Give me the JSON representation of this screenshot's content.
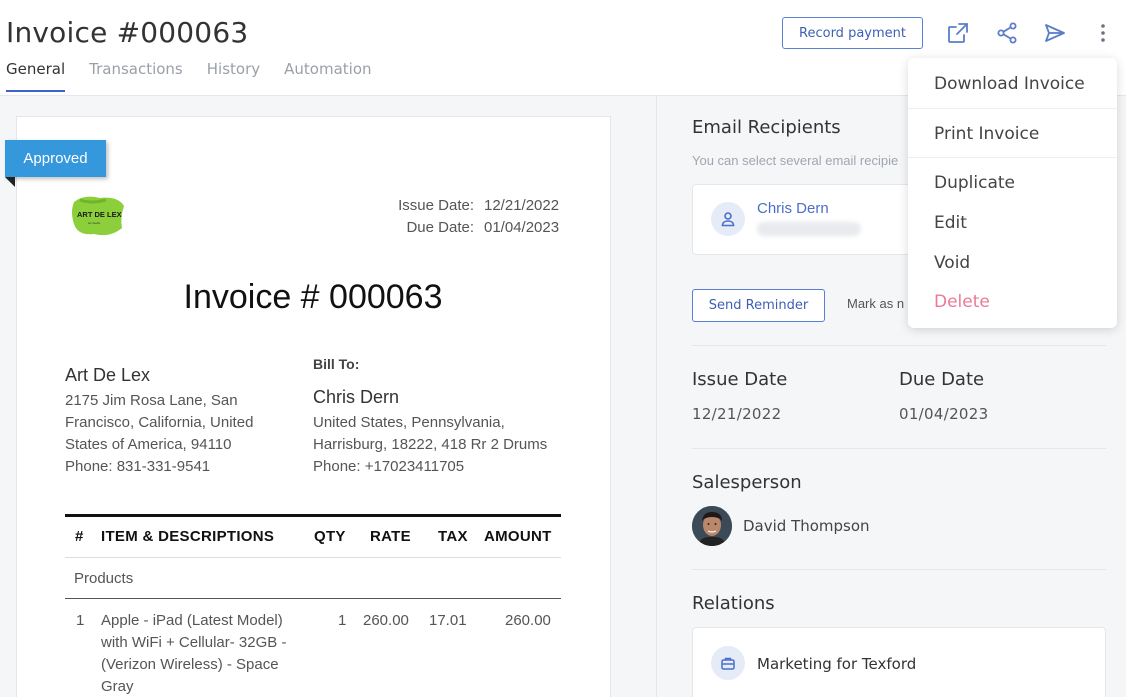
{
  "header": {
    "title": "Invoice #000063",
    "tabs": [
      {
        "label": "General",
        "active": true
      },
      {
        "label": "Transactions",
        "active": false
      },
      {
        "label": "History",
        "active": false
      },
      {
        "label": "Automation",
        "active": false
      }
    ],
    "record_payment_label": "Record payment",
    "icons": [
      "external-link-icon",
      "share-icon",
      "send-icon",
      "more-vertical-icon"
    ]
  },
  "invoice": {
    "status": "Approved",
    "logo_text": "ART DE LEX",
    "issue_date_label": "Issue Date:",
    "issue_date": "12/21/2022",
    "due_date_label": "Due Date:",
    "due_date": "01/04/2023",
    "heading": "Invoice # 000063",
    "from": {
      "name": "Art De Lex",
      "address_lines": [
        "2175 Jim Rosa Lane, San",
        "Francisco, California, United",
        "States of America, 94110",
        "Phone: 831-331-9541"
      ]
    },
    "bill_to_label": "Bill To:",
    "to": {
      "name": "Chris Dern",
      "address_lines": [
        "United States, Pennsylvania,",
        "Harrisburg, 18222, 418 Rr 2 Drums",
        "Phone: +17023411705"
      ]
    },
    "table": {
      "headers": [
        "#",
        "ITEM & DESCRIPTIONS",
        "QTY",
        "RATE",
        "TAX",
        "AMOUNT"
      ],
      "group": "Products",
      "rows": [
        {
          "num": "1",
          "item_lines": [
            "Apple - iPad (Latest Model)",
            "with WiFi + Cellular- 32GB -",
            "(Verizon Wireless) - Space",
            "Gray"
          ],
          "qty": "1",
          "rate": "260.00",
          "tax": "17.01",
          "amount": "260.00"
        }
      ]
    }
  },
  "sidebar": {
    "email_recipients_title": "Email Recipients",
    "email_recipients_sub": "You can select several email recipie",
    "recipient_name": "Chris Dern",
    "send_reminder_label": "Send Reminder",
    "mark_as_label": "Mark as n",
    "issue_date_title": "Issue Date",
    "issue_date_value": "12/21/2022",
    "due_date_title": "Due Date",
    "due_date_value": "01/04/2023",
    "salesperson_title": "Salesperson",
    "salesperson_name": "David Thompson",
    "relations_title": "Relations",
    "relation_name": "Marketing for Texford"
  },
  "menu": {
    "items": [
      {
        "label": "Download Invoice"
      },
      {
        "label": "Print Invoice"
      },
      {
        "label": "Duplicate"
      },
      {
        "label": "Edit"
      },
      {
        "label": "Void"
      },
      {
        "label": "Delete"
      }
    ]
  },
  "colors": {
    "accent": "#3e63c4",
    "ribbon": "#3597dc",
    "danger": "#ec7a96"
  }
}
